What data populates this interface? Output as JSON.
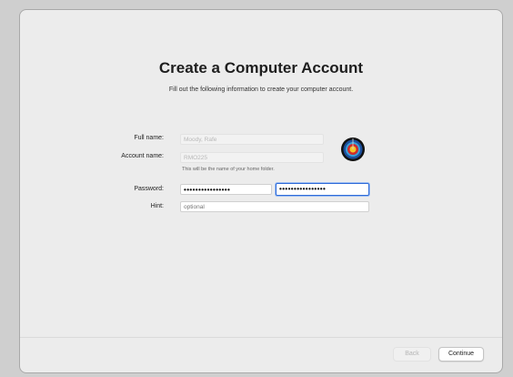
{
  "page": {
    "title": "Create a Computer Account",
    "subtitle": "Fill out the following information to create your computer account."
  },
  "form": {
    "full_name_label": "Full name:",
    "full_name_value": "Moody, Rafe",
    "account_name_label": "Account name:",
    "account_name_value": "RMO225",
    "account_note": "This will be the name of your home folder.",
    "password_label": "Password:",
    "password_value": "••••••••••••••••",
    "verify_value": "••••••••••••••••",
    "hint_label": "Hint:",
    "hint_placeholder": "optional"
  },
  "avatar": {
    "icon": "archery-target-icon"
  },
  "footer": {
    "back_label": "Back",
    "continue_label": "Continue"
  },
  "colors": {
    "focus": "#2f6bd8",
    "window_bg": "#ececec"
  }
}
